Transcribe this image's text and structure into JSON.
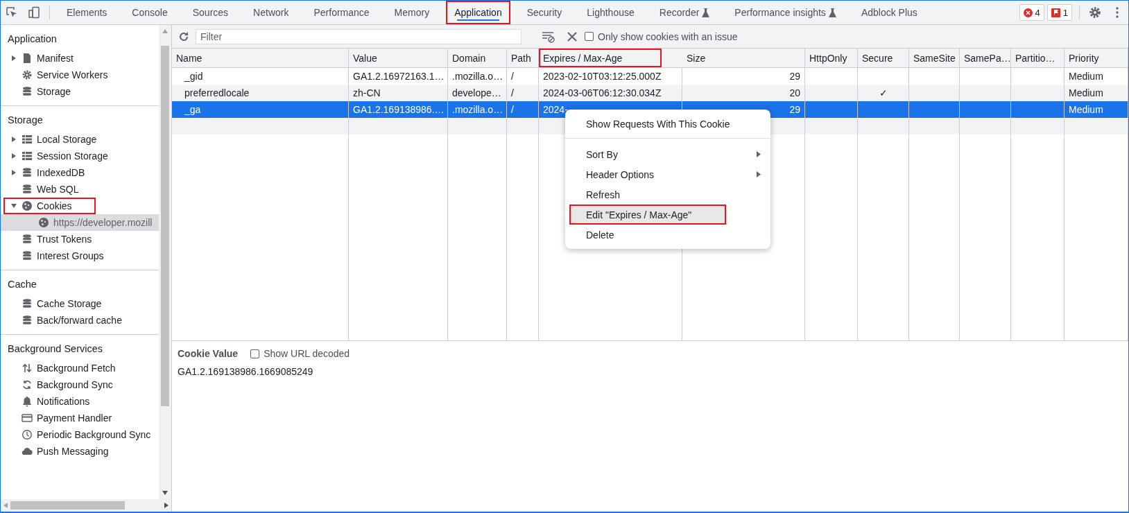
{
  "top_bar": {
    "tabs": [
      {
        "label": "Elements",
        "selected": false,
        "experimental": false,
        "annotated": false
      },
      {
        "label": "Console",
        "selected": false,
        "experimental": false,
        "annotated": false
      },
      {
        "label": "Sources",
        "selected": false,
        "experimental": false,
        "annotated": false
      },
      {
        "label": "Network",
        "selected": false,
        "experimental": false,
        "annotated": false
      },
      {
        "label": "Performance",
        "selected": false,
        "experimental": false,
        "annotated": false
      },
      {
        "label": "Memory",
        "selected": false,
        "experimental": false,
        "annotated": false
      },
      {
        "label": "Application",
        "selected": true,
        "experimental": false,
        "annotated": true
      },
      {
        "label": "Security",
        "selected": false,
        "experimental": false,
        "annotated": false
      },
      {
        "label": "Lighthouse",
        "selected": false,
        "experimental": false,
        "annotated": false
      },
      {
        "label": "Recorder",
        "selected": false,
        "experimental": true,
        "annotated": false
      },
      {
        "label": "Performance insights",
        "selected": false,
        "experimental": true,
        "annotated": false
      },
      {
        "label": "Adblock Plus",
        "selected": false,
        "experimental": false,
        "annotated": false
      }
    ],
    "errors": "4",
    "issues": "1"
  },
  "sidebar": {
    "sections": [
      {
        "title": "Application",
        "items": [
          {
            "label": "Manifest",
            "kind": "file",
            "expanded": false,
            "selected": false,
            "annotated": false
          },
          {
            "label": "Service Workers",
            "kind": "gear",
            "selected": false,
            "annotated": false
          },
          {
            "label": "Storage",
            "kind": "database",
            "selected": false,
            "annotated": false
          }
        ]
      },
      {
        "title": "Storage",
        "items": [
          {
            "label": "Local Storage",
            "kind": "grid",
            "expanded": false,
            "selected": false,
            "annotated": false
          },
          {
            "label": "Session Storage",
            "kind": "grid",
            "expanded": false,
            "selected": false,
            "annotated": false
          },
          {
            "label": "IndexedDB",
            "kind": "database",
            "expanded": false,
            "selected": false,
            "annotated": false
          },
          {
            "label": "Web SQL",
            "kind": "database",
            "selected": false,
            "annotated": false
          },
          {
            "label": "Cookies",
            "kind": "cookie",
            "expanded": true,
            "selected": false,
            "annotated": true,
            "children": [
              {
                "label": "https://developer.mozill",
                "kind": "cookie",
                "selected": true,
                "annotated": false
              }
            ]
          },
          {
            "label": "Trust Tokens",
            "kind": "database",
            "selected": false,
            "annotated": false
          },
          {
            "label": "Interest Groups",
            "kind": "database",
            "selected": false,
            "annotated": false
          }
        ]
      },
      {
        "title": "Cache",
        "items": [
          {
            "label": "Cache Storage",
            "kind": "database",
            "selected": false,
            "annotated": false
          },
          {
            "label": "Back/forward cache",
            "kind": "database",
            "selected": false,
            "annotated": false
          }
        ]
      },
      {
        "title": "Background Services",
        "items": [
          {
            "label": "Background Fetch",
            "kind": "updown",
            "selected": false,
            "annotated": false
          },
          {
            "label": "Background Sync",
            "kind": "sync",
            "selected": false,
            "annotated": false
          },
          {
            "label": "Notifications",
            "kind": "bell",
            "selected": false,
            "annotated": false
          },
          {
            "label": "Payment Handler",
            "kind": "card",
            "selected": false,
            "annotated": false
          },
          {
            "label": "Periodic Background Sync",
            "kind": "clock",
            "selected": false,
            "annotated": false
          },
          {
            "label": "Push Messaging",
            "kind": "cloud",
            "selected": false,
            "annotated": false
          }
        ]
      }
    ]
  },
  "toolbar": {
    "filter": {
      "placeholder": "Filter"
    },
    "issue_only": {
      "label": "Only show cookies with an issue",
      "checked": false
    }
  },
  "table": {
    "columns": [
      {
        "label": "Name",
        "annotated": false
      },
      {
        "label": "Value",
        "annotated": false
      },
      {
        "label": "Domain",
        "annotated": false
      },
      {
        "label": "Path",
        "annotated": false
      },
      {
        "label": "Expires / Max-Age",
        "annotated": true
      },
      {
        "label": "Size",
        "annotated": false
      },
      {
        "label": "HttpOnly",
        "annotated": false
      },
      {
        "label": "Secure",
        "annotated": false
      },
      {
        "label": "SameSite",
        "annotated": false
      },
      {
        "label": "SamePa…",
        "annotated": false
      },
      {
        "label": "Partitio…",
        "annotated": false
      },
      {
        "label": "Priority",
        "annotated": false
      }
    ],
    "rows": [
      {
        "selected": false,
        "cells": [
          "_gid",
          "GA1.2.16972163.1…",
          ".mozilla.o…",
          "/",
          "2023-02-10T03:12:25.000Z",
          "29",
          "",
          "",
          "",
          "",
          "",
          "Medium"
        ]
      },
      {
        "selected": false,
        "cells": [
          "preferredlocale",
          "zh-CN",
          "develope…",
          "/",
          "2024-03-06T06:12:30.034Z",
          "20",
          "",
          "✓",
          "",
          "",
          "",
          "Medium"
        ]
      },
      {
        "selected": true,
        "cells": [
          "_ga",
          "GA1.2.169138986.…",
          ".mozilla.o…",
          "/",
          "2024-",
          "29",
          "",
          "",
          "",
          "",
          "",
          "Medium"
        ]
      }
    ]
  },
  "context_menu": {
    "items": [
      {
        "label": "Show Requests With This Cookie",
        "submenu": false,
        "separator_after": true,
        "highlighted": false,
        "annotated": false
      },
      {
        "label": "Sort By",
        "submenu": true,
        "separator_after": false,
        "highlighted": false,
        "annotated": false
      },
      {
        "label": "Header Options",
        "submenu": true,
        "separator_after": false,
        "highlighted": false,
        "annotated": false
      },
      {
        "label": "Refresh",
        "submenu": false,
        "separator_after": false,
        "highlighted": false,
        "annotated": false
      },
      {
        "label": "Edit \"Expires / Max-Age\"",
        "submenu": false,
        "separator_after": false,
        "highlighted": true,
        "annotated": true
      },
      {
        "label": "Delete",
        "submenu": false,
        "separator_after": false,
        "highlighted": false,
        "annotated": false
      }
    ]
  },
  "cookie_value": {
    "title": "Cookie Value",
    "url_decoded": {
      "label": "Show URL decoded",
      "checked": false
    },
    "value": "GA1.2.169138986.1669085249"
  }
}
